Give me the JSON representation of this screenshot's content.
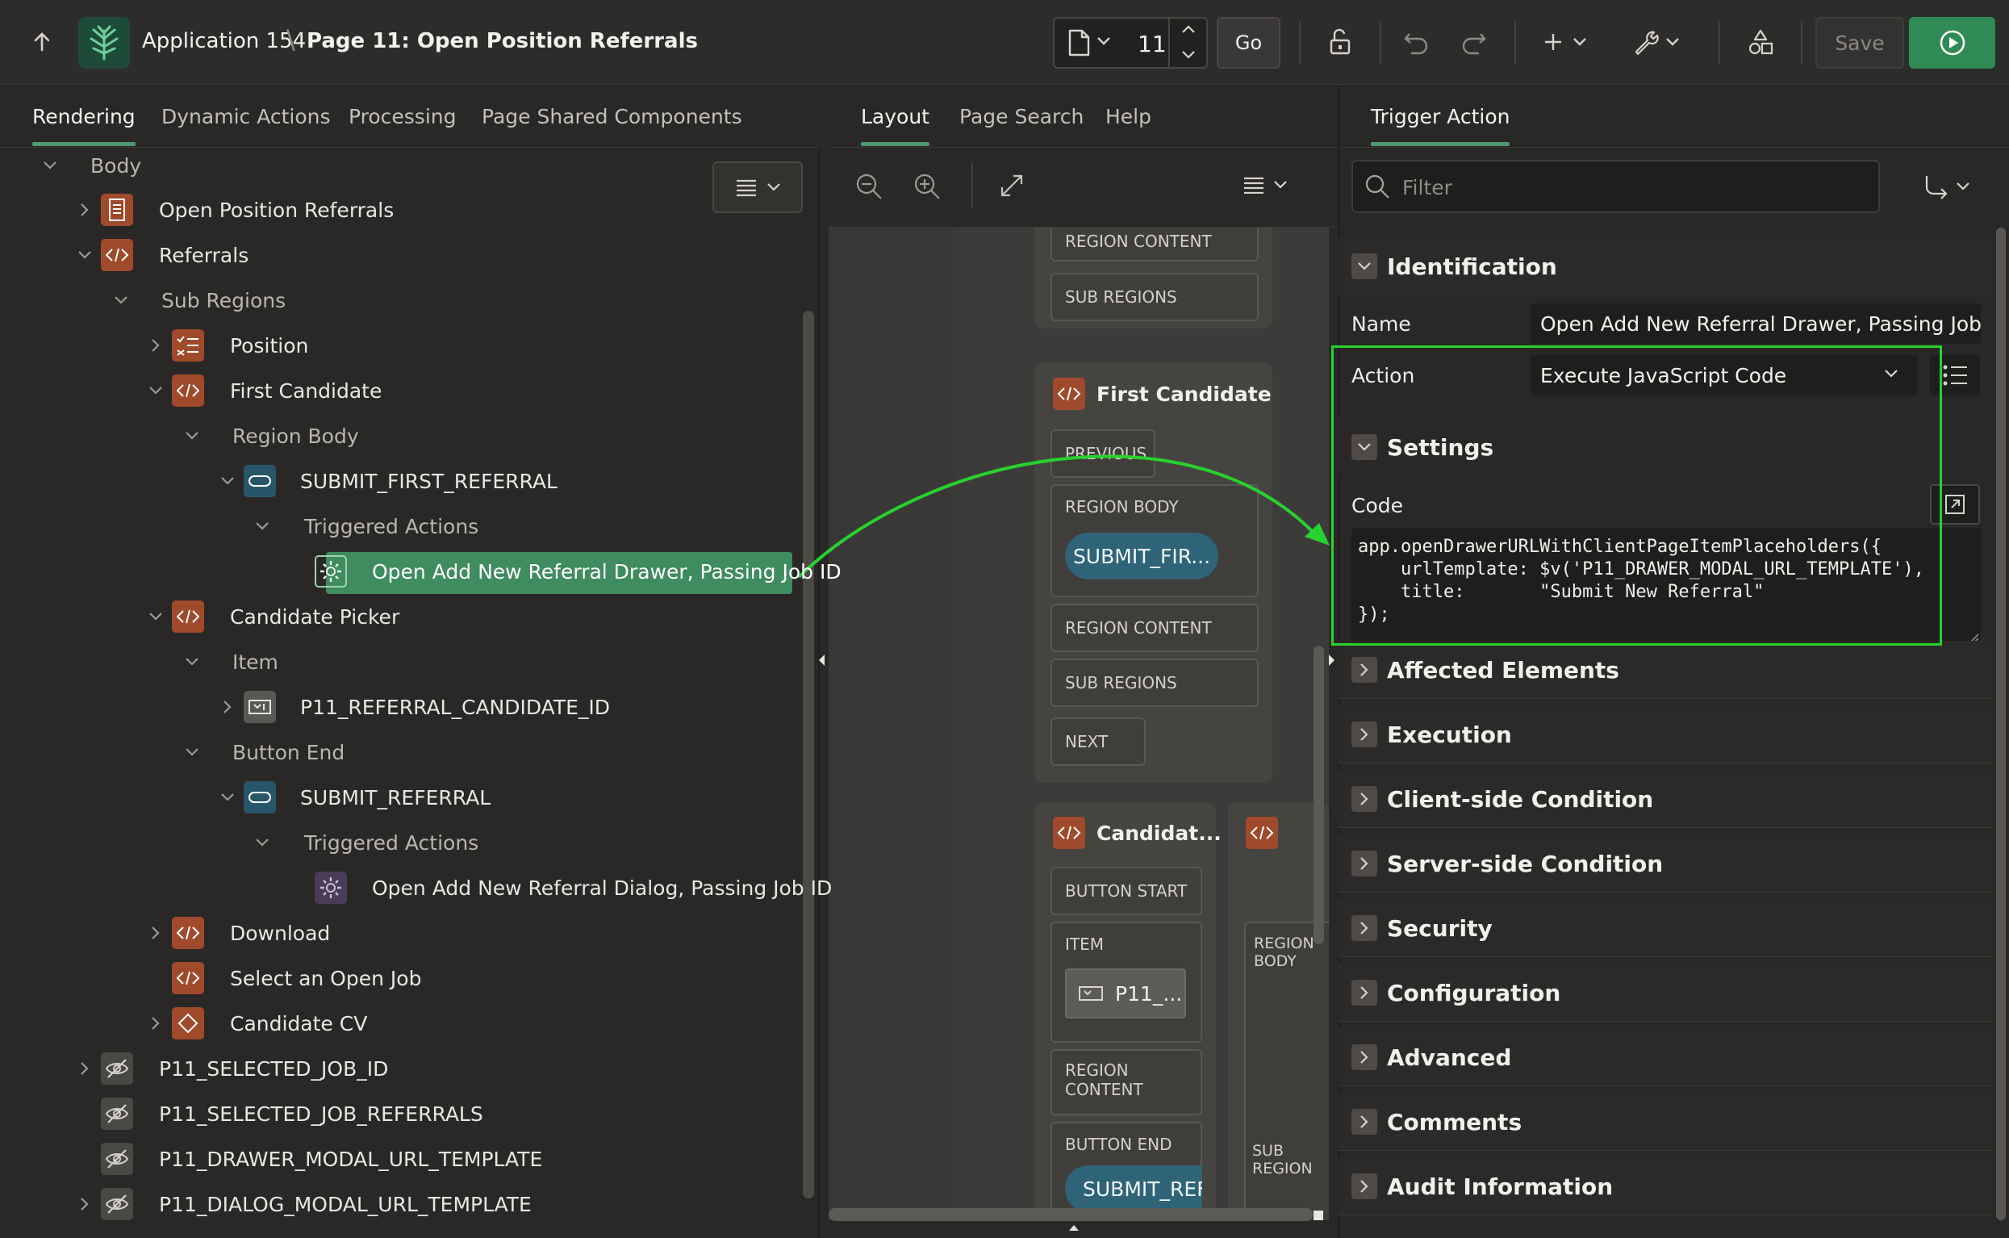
{
  "header": {
    "app_name": "Application 154",
    "page_name": "Page 11: Open Position Referrals",
    "page_number": "11",
    "go_label": "Go",
    "save_label": "Save"
  },
  "left_tabs": [
    "Rendering",
    "Dynamic Actions",
    "Processing",
    "Page Shared Components"
  ],
  "tree": {
    "body": "Body",
    "open_position_referrals": "Open Position Referrals",
    "referrals": "Referrals",
    "sub_regions": "Sub Regions",
    "position": "Position",
    "first_candidate": "First Candidate",
    "region_body": "Region Body",
    "submit_first_referral": "SUBMIT_FIRST_REFERRAL",
    "triggered_actions_1": "Triggered Actions",
    "selected_action": "Open Add New Referral Drawer, Passing Job ID",
    "candidate_picker": "Candidate Picker",
    "item": "Item",
    "candidate_id": "P11_REFERRAL_CANDIDATE_ID",
    "button_end": "Button End",
    "submit_referral": "SUBMIT_REFERRAL",
    "triggered_actions_2": "Triggered Actions",
    "dialog_action": "Open Add New Referral Dialog, Passing Job ID",
    "download": "Download",
    "select_job": "Select an Open Job",
    "candidate_cv": "Candidate CV",
    "selected_job_id": "P11_SELECTED_JOB_ID",
    "selected_job_referrals": "P11_SELECTED_JOB_REFERRALS",
    "drawer_url": "P11_DRAWER_MODAL_URL_TEMPLATE",
    "dialog_url": "P11_DIALOG_MODAL_URL_TEMPLATE"
  },
  "mid_tabs": [
    "Layout",
    "Page Search",
    "Help"
  ],
  "layout": {
    "region_content_1": "REGION CONTENT",
    "sub_regions_1": "SUB REGIONS",
    "first_candidate_title": "First Candidate",
    "previous": "PREVIOUS",
    "region_body": "REGION BODY",
    "submit_first_pill": "SUBMIT_FIR...",
    "region_content_2": "REGION CONTENT",
    "sub_regions_2": "SUB REGIONS",
    "next": "NEXT",
    "candidate_title": "Candidat...",
    "button_start": "BUTTON START",
    "item": "ITEM",
    "item_pill": "P11_...",
    "region_content_3": "REGION CONTENT",
    "button_end": "BUTTON END",
    "submit_ref_pill": "SUBMIT_REFE",
    "region_body_side": "REGION BODY",
    "sub_region_side": "SUB REGION"
  },
  "right_tabs": [
    "Trigger Action"
  ],
  "filter_placeholder": "Filter",
  "properties": {
    "identification": "Identification",
    "name_label": "Name",
    "name_value": "Open Add New Referral Drawer, Passing Job ID",
    "action_label": "Action",
    "action_value": "Execute JavaScript Code",
    "settings": "Settings",
    "code_label": "Code",
    "code_lines": [
      "app.openDrawerURLWithClientPageItemPlaceholders({",
      "    urlTemplate: $v('P11_DRAWER_MODAL_URL_TEMPLATE'),",
      "    title:       \"Submit New Referral\"",
      "});"
    ],
    "groups": [
      "Affected Elements",
      "Execution",
      "Client-side Condition",
      "Server-side Condition",
      "Security",
      "Configuration",
      "Advanced",
      "Comments",
      "Audit Information"
    ]
  },
  "colors": {
    "accent": "#4b9a73",
    "selected_row": "#3f8c5e",
    "highlight_box": "#27d22e",
    "run_button": "#2f8a54"
  }
}
